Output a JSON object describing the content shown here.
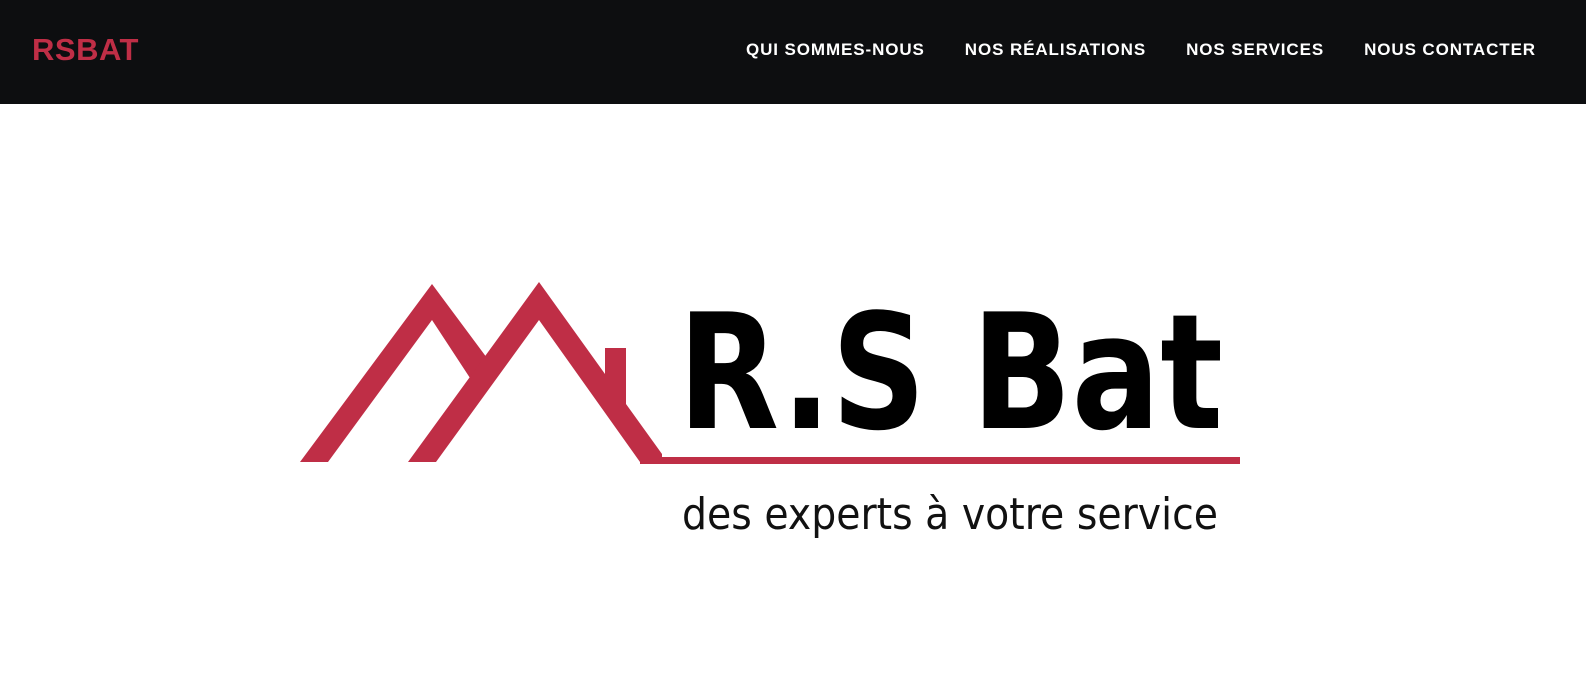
{
  "header": {
    "brand": "RSBAT",
    "nav": [
      {
        "label": "QUI SOMMES-NOUS"
      },
      {
        "label": "NOS RÉALISATIONS"
      },
      {
        "label": "NOS SERVICES"
      },
      {
        "label": "NOUS CONTACTER"
      }
    ]
  },
  "hero": {
    "logo": {
      "name": "R.S Bat",
      "tagline": "des experts à votre service",
      "icon": "roof-icon"
    }
  },
  "colors": {
    "navbar_bg": "#0d0e10",
    "brand_red": "#bf2e46",
    "nav_text": "#ffffff",
    "logo_text": "#000000"
  }
}
